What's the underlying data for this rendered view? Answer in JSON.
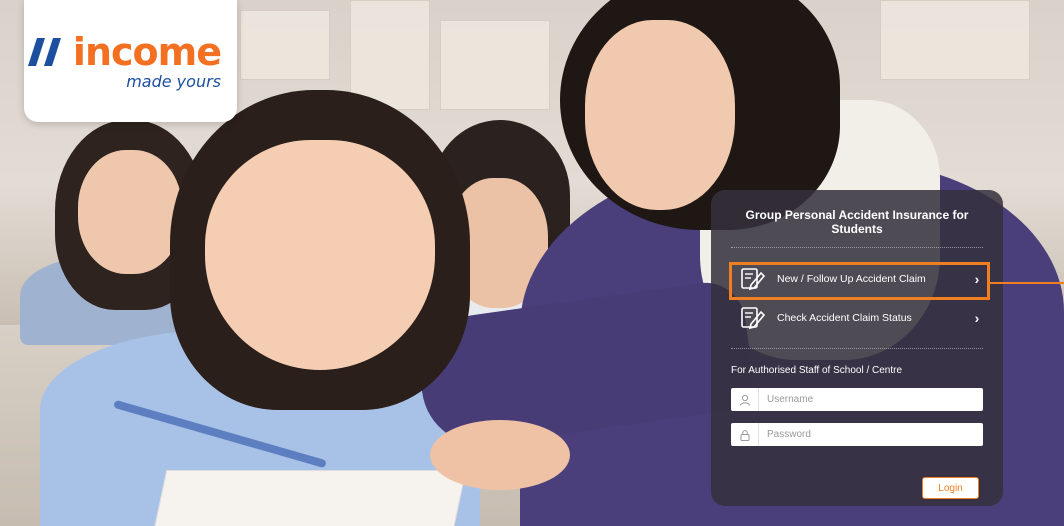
{
  "logo": {
    "wordmark": "income",
    "tagline": "made yours"
  },
  "panel": {
    "title": "Group Personal Accident Insurance for Students",
    "menu": [
      {
        "label": "New / Follow Up Accident Claim",
        "icon": "claim-form-pen-icon",
        "chevron": "›"
      },
      {
        "label": "Check Accident Claim Status",
        "icon": "claim-form-pen-icon",
        "chevron": "›"
      }
    ],
    "staff_label": "For Authorised Staff of School / Centre",
    "username_placeholder": "Username",
    "password_placeholder": "Password",
    "login_label": "Login"
  },
  "colors": {
    "brand_orange": "#f36f21",
    "brand_blue": "#1d4f9f",
    "highlight": "#f07f22",
    "panel_bg": "rgba(52,48,60,0.86)"
  }
}
